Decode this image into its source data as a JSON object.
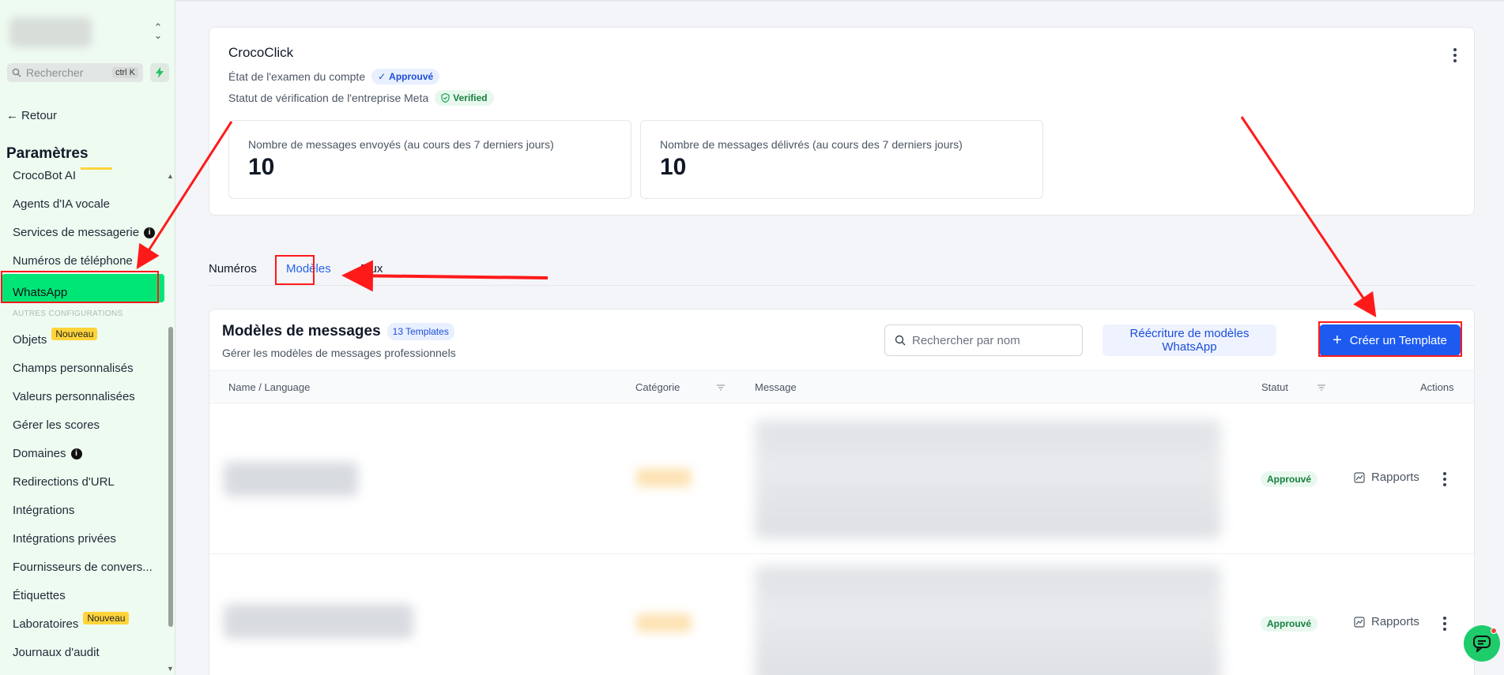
{
  "sidebar": {
    "search": {
      "placeholder": "Rechercher",
      "shortcut": "ctrl K"
    },
    "back_label": "Retour",
    "title": "Paramètres",
    "items": [
      {
        "label": "CrocoBot AI",
        "badge": ""
      },
      {
        "label": "Agents d'IA vocale"
      },
      {
        "label": "Services de messagerie"
      },
      {
        "label": "Numéros de téléphone"
      },
      {
        "label": "WhatsApp"
      },
      {
        "label": "Objets",
        "badge": "Nouveau"
      },
      {
        "label": "Champs personnalisés"
      },
      {
        "label": "Valeurs personnalisées"
      },
      {
        "label": "Gérer les scores"
      },
      {
        "label": "Domaines"
      },
      {
        "label": "Redirections d'URL"
      },
      {
        "label": "Intégrations"
      },
      {
        "label": "Intégrations privées"
      },
      {
        "label": "Fournisseurs de convers..."
      },
      {
        "label": "Étiquettes"
      },
      {
        "label": "Laboratoires",
        "badge": "Nouveau"
      },
      {
        "label": "Journaux d'audit"
      }
    ],
    "section_other": "AUTRES CONFIGURATIONS"
  },
  "account": {
    "name": "CrocoClick",
    "review_label": "État de l'examen du compte",
    "review_status": "Approuvé",
    "meta_label": "Statut de vérification de l'entreprise Meta",
    "meta_status": "Verified"
  },
  "stats": [
    {
      "label": "Nombre de messages envoyés (au cours des 7 derniers jours)",
      "value": "10"
    },
    {
      "label": "Nombre de messages délivrés (au cours des 7 derniers jours)",
      "value": "10"
    }
  ],
  "tabs": [
    {
      "label": "Numéros"
    },
    {
      "label": "Modèles"
    },
    {
      "label": "Flux"
    }
  ],
  "templates": {
    "title": "Modèles de messages",
    "count": "13 Templates",
    "subtitle": "Gérer les modèles de messages professionnels",
    "search_placeholder": "Rechercher par nom",
    "rewrite_label": "Réécriture de modèles WhatsApp",
    "create_label": "Créer un Template",
    "columns": [
      "Name / Language",
      "Catégorie",
      "Message",
      "Statut",
      "Actions"
    ],
    "rows": [
      {
        "status": "Approuvé",
        "action": "Rapports"
      },
      {
        "status": "Approuvé",
        "action": "Rapports"
      }
    ]
  },
  "colors": {
    "accent": "#1d5bf0",
    "active_nav": "#00e676",
    "annotation": "#ff1a1a"
  }
}
